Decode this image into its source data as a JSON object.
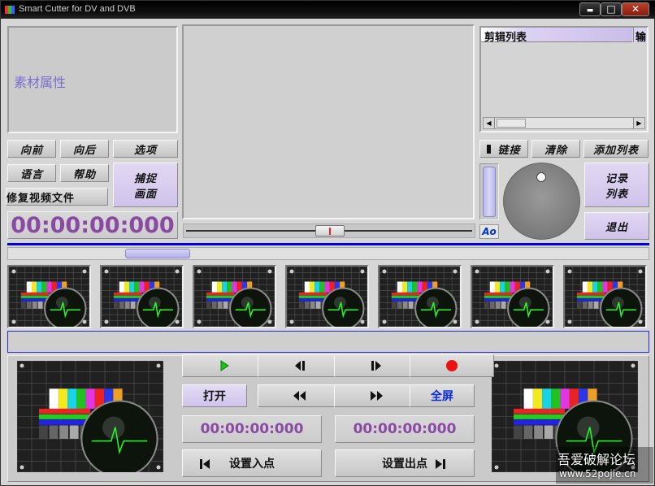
{
  "window": {
    "title": "Smart Cutter for DV and DVB",
    "minimize": "▬",
    "maximize": "□",
    "close": "✕"
  },
  "properties": {
    "label": "素材属性"
  },
  "clip_list": {
    "header": "剪辑列表",
    "header2": "输"
  },
  "buttons": {
    "forward": "向前",
    "backward": "向后",
    "options": "选项",
    "language": "语言",
    "help": "帮助",
    "capture_line1": "捕捉",
    "capture_line2": "画面",
    "repair": "修复视频文件",
    "link": "链接",
    "clear": "清除",
    "add_list": "添加列表",
    "record_line1": "记录",
    "record_line2": "列表",
    "exit": "退出",
    "ao": "Ao",
    "open": "打开",
    "fullscreen": "全屏",
    "set_in": "设置入点",
    "set_out": "设置出点"
  },
  "timecodes": {
    "main": "00:00:00:000",
    "in_point": "00:00:00:000",
    "out_point": "00:00:00:000"
  },
  "watermark": {
    "line1": "吾爱破解论坛",
    "line2": "www.52pojie.cn"
  },
  "colors": {
    "accent_blue": "#0000e6",
    "timecode_purple": "#8a4aa4",
    "properties_label": "#7a6fd0"
  }
}
